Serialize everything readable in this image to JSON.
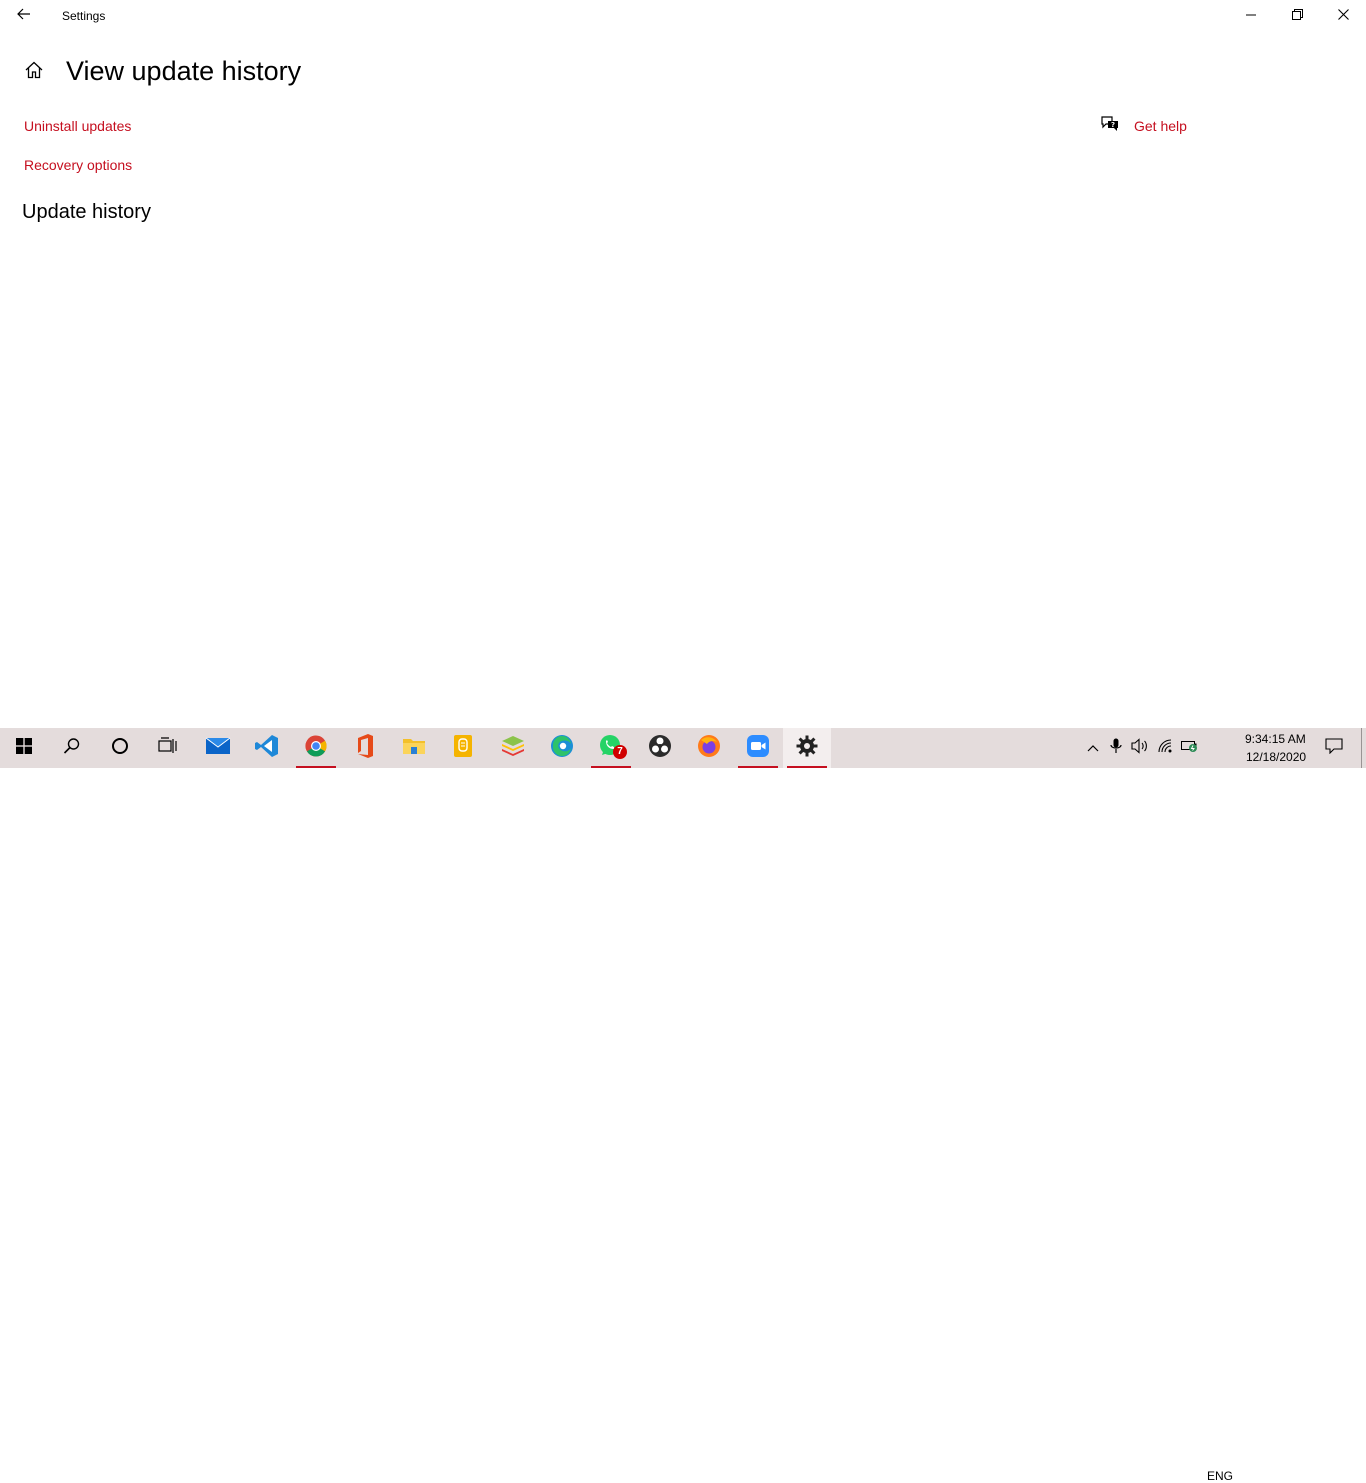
{
  "titlebar": {
    "title": "Settings",
    "back_icon": "back-arrow-icon",
    "controls": [
      "minimize-icon",
      "restore-icon",
      "close-icon"
    ]
  },
  "page": {
    "title": "View update history",
    "home_icon": "home-icon",
    "links": {
      "uninstall": "Uninstall updates",
      "recovery": "Recovery options"
    },
    "help": {
      "label": "Get help",
      "icon": "chat-help-icon"
    },
    "section_title": "Update history"
  },
  "colors": {
    "accent": "#c50f1f",
    "taskbar_bg": "#e4dcdc"
  },
  "taskbar": {
    "apps": [
      {
        "name": "start-button",
        "icon": "windows-logo-icon"
      },
      {
        "name": "search-button",
        "icon": "search-icon"
      },
      {
        "name": "cortana-button",
        "icon": "cortana-circle-icon"
      },
      {
        "name": "task-view-button",
        "icon": "task-view-icon"
      },
      {
        "name": "mail-app",
        "icon": "mail-icon"
      },
      {
        "name": "vscode-app",
        "icon": "vscode-icon"
      },
      {
        "name": "chrome-app",
        "icon": "chrome-icon"
      },
      {
        "name": "office-app",
        "icon": "office-icon"
      },
      {
        "name": "file-explorer-app",
        "icon": "folder-icon"
      },
      {
        "name": "notes-app",
        "icon": "notes-icon"
      },
      {
        "name": "bluestacks-app",
        "icon": "bluestacks-icon"
      },
      {
        "name": "edge-app",
        "icon": "edge-icon"
      },
      {
        "name": "whatsapp-app",
        "icon": "whatsapp-icon",
        "badge": "7"
      },
      {
        "name": "obs-app",
        "icon": "obs-icon"
      },
      {
        "name": "firefox-app",
        "icon": "firefox-icon"
      },
      {
        "name": "zoom-app",
        "icon": "zoom-icon"
      },
      {
        "name": "settings-app",
        "icon": "gear-icon"
      }
    ],
    "tray": {
      "language": "ENG",
      "time": "9:34:15 AM",
      "date": "12/18/2020"
    }
  }
}
